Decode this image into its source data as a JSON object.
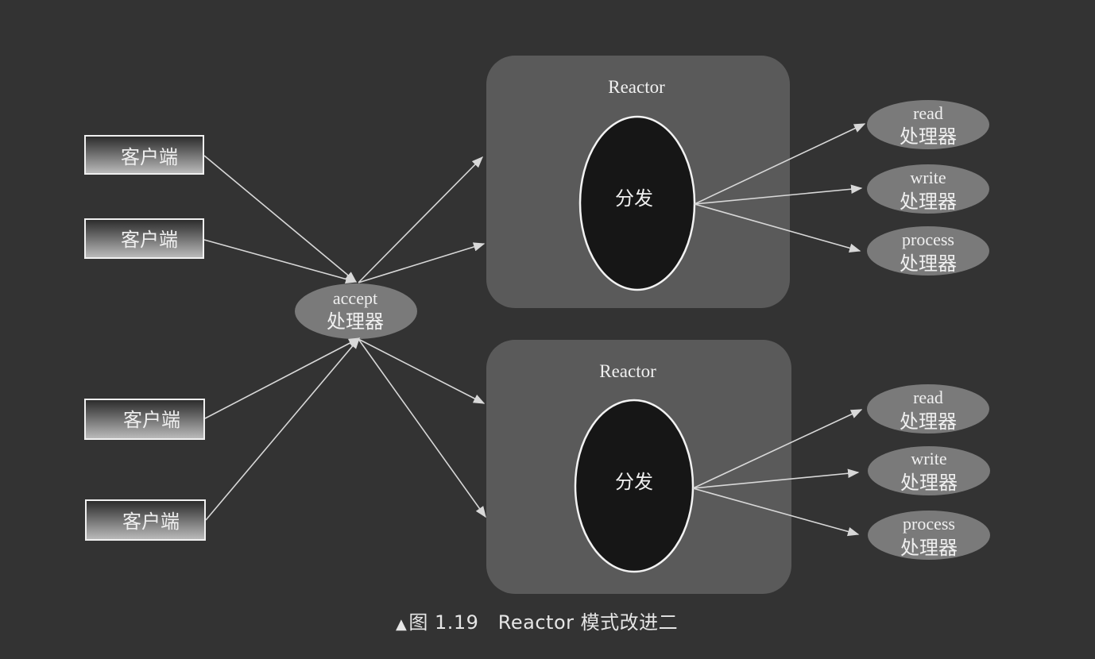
{
  "clients": [
    {
      "label": "客户端"
    },
    {
      "label": "客户端"
    },
    {
      "label": "客户端"
    },
    {
      "label": "客户端"
    }
  ],
  "acceptor": {
    "line1": "accept",
    "line2": "处理器"
  },
  "reactors": [
    {
      "title": "Reactor",
      "dispatcher": "分发",
      "handlers": [
        {
          "line1": "read",
          "line2": "处理器"
        },
        {
          "line1": "write",
          "line2": "处理器"
        },
        {
          "line1": "process",
          "line2": "处理器"
        }
      ]
    },
    {
      "title": "Reactor",
      "dispatcher": "分发",
      "handlers": [
        {
          "line1": "read",
          "line2": "处理器"
        },
        {
          "line1": "write",
          "line2": "处理器"
        },
        {
          "line1": "process",
          "line2": "处理器"
        }
      ]
    }
  ],
  "caption": {
    "marker": "▲",
    "text": "图 1.19   Reactor 模式改进二"
  },
  "colors": {
    "background": "#333333",
    "reactor_panel": "#5a5a5a",
    "dispatcher_fill": "#161616",
    "handler_fill": "#7a7a7a",
    "arrow": "#d8d8d8",
    "text": "#f0f0f0"
  }
}
